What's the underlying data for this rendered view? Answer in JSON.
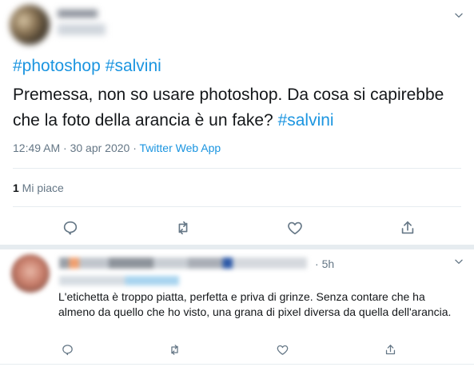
{
  "tweet": {
    "hashtags": [
      "#photoshop",
      "#salvini"
    ],
    "text": "Premessa, non so usare photoshop. Da cosa si capirebbe che la foto della arancia è un fake? ",
    "text_hashtag": "#salvini",
    "timestamp": "12:49 AM · 30 apr 2020 · ",
    "source": "Twitter Web App",
    "likes_count": "1",
    "likes_label": " Mi piace",
    "colors": {
      "link": "#1b95e0",
      "secondary": "#657786",
      "text": "#14171a"
    }
  },
  "icons": {
    "menu": "chevron-down-icon",
    "reply": "reply-icon",
    "retweet": "retweet-icon",
    "like": "heart-icon",
    "share": "share-icon"
  },
  "reply": {
    "separator": "·",
    "time": "5h",
    "text": "L'etichetta è troppo piatta, perfetta e priva di grinze. Senza contare che ha almeno da quello che ho visto, una grana di pixel diversa da quella dell'arancia."
  }
}
